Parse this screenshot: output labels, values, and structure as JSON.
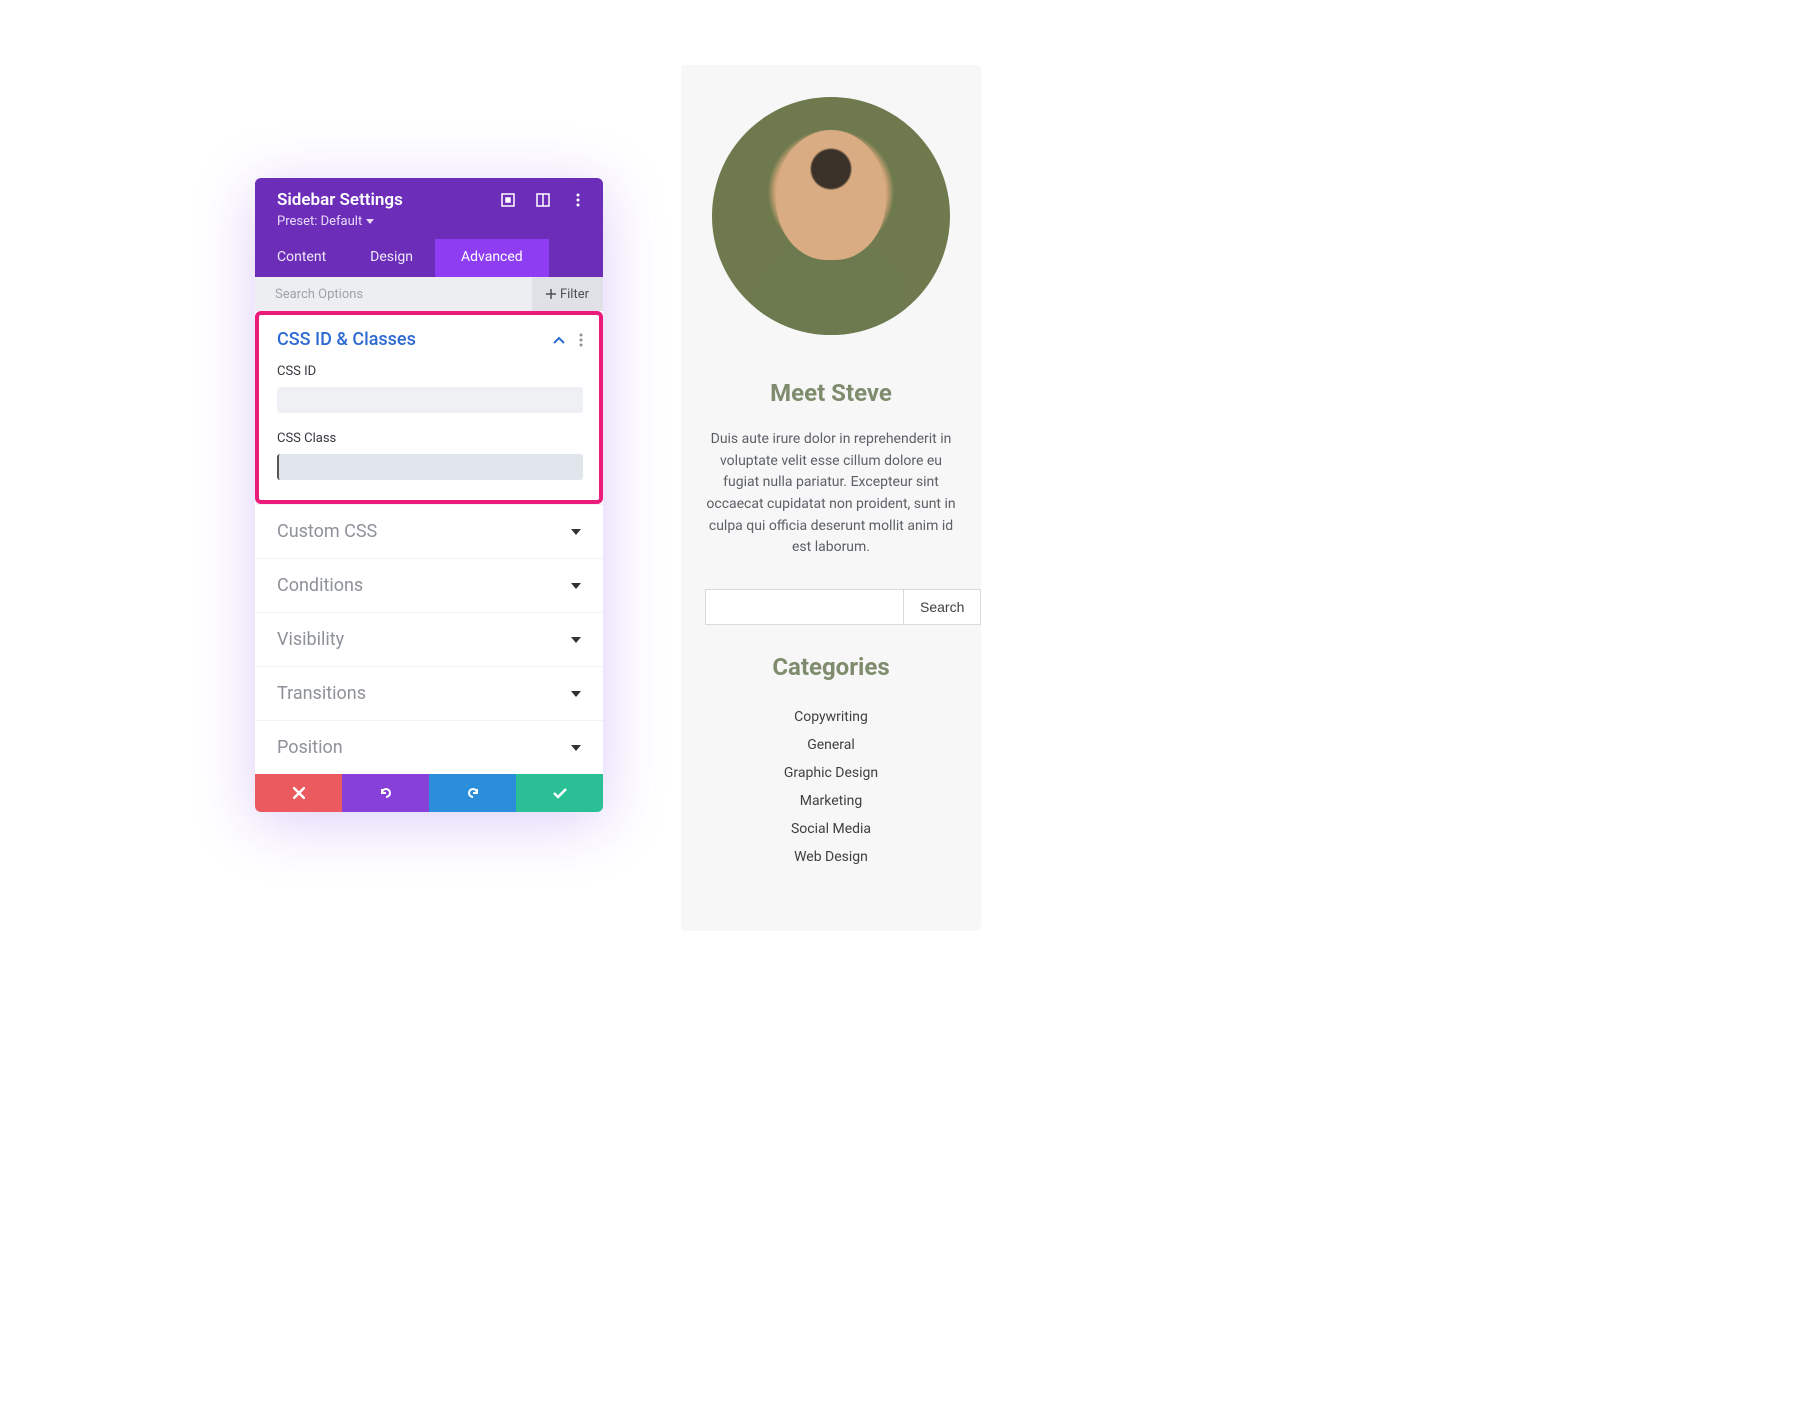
{
  "panel": {
    "title": "Sidebar Settings",
    "preset": "Preset: Default",
    "tabs": {
      "content": "Content",
      "design": "Design",
      "advanced": "Advanced"
    },
    "search_placeholder": "Search Options",
    "filter_label": "Filter",
    "open_section": {
      "title": "CSS ID & Classes",
      "css_id_label": "CSS ID",
      "css_id_value": "",
      "css_class_label": "CSS Class",
      "css_class_value": ""
    },
    "sections": {
      "custom_css": "Custom CSS",
      "conditions": "Conditions",
      "visibility": "Visibility",
      "transitions": "Transitions",
      "position": "Position"
    }
  },
  "preview": {
    "heading": "Meet Steve",
    "body": "Duis aute irure dolor in reprehenderit in voluptate velit esse cillum dolore eu fugiat nulla pariatur. Excepteur sint occaecat cupidatat non proident, sunt in culpa qui officia deserunt mollit anim id est laborum.",
    "search_button": "Search",
    "categories_heading": "Categories",
    "categories": [
      "Copywriting",
      "General",
      "Graphic Design",
      "Marketing",
      "Social Media",
      "Web Design"
    ]
  },
  "colors": {
    "accent_purple": "#6c2eb9",
    "accent_purple_light": "#8e3df2",
    "highlight_pink": "#ec1a7a",
    "heading_olive": "#7e8c6d"
  }
}
